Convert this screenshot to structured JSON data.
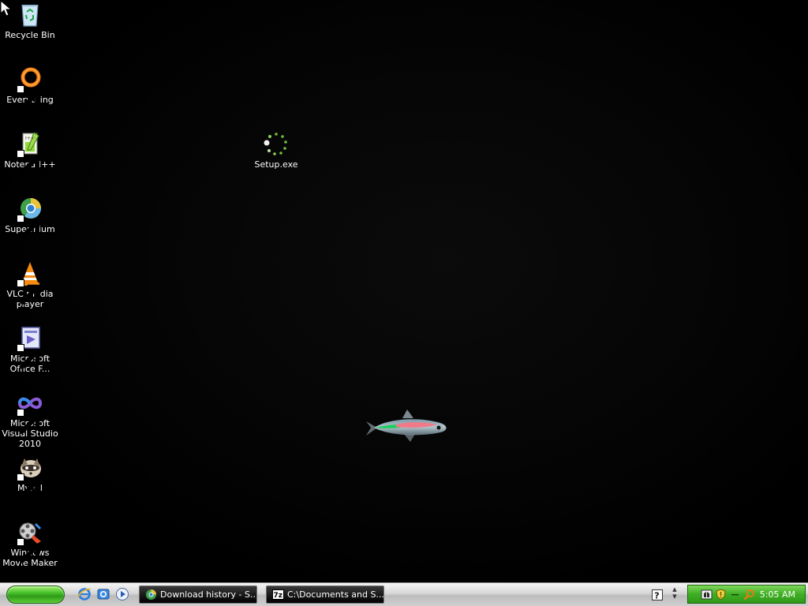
{
  "desktop": {
    "icons": [
      {
        "label": "Recycle Bin",
        "icon": "recycle-bin-icon"
      },
      {
        "label": "Everything",
        "icon": "everything-icon"
      },
      {
        "label": "Notepad++",
        "icon": "notepad-plus-plus-icon"
      },
      {
        "label": "Supermium",
        "icon": "supermium-icon"
      },
      {
        "label": "VLC media player",
        "icon": "vlc-icon"
      },
      {
        "label": "Microsoft Office F...",
        "icon": "office-frontpage-icon"
      },
      {
        "label": "Microsoft Visual Studio 2010",
        "icon": "visual-studio-icon"
      },
      {
        "label": "MyPal",
        "icon": "mypal-icon"
      },
      {
        "label": "Windows Movie Maker",
        "icon": "movie-maker-icon"
      },
      {
        "label": "Setup.exe",
        "icon": "setup-loading-icon"
      }
    ]
  },
  "taskbar": {
    "start_icon": "start-button",
    "quick_launch": [
      "internet-explorer-icon",
      "show-desktop-icon",
      "media-player-icon"
    ],
    "tasks": [
      {
        "label": "Download history - S...",
        "icon": "supermium-icon"
      },
      {
        "label": "C:\\Documents and S...",
        "icon": "7zip-icon"
      }
    ],
    "tray_icons": [
      "network-icon",
      "security-shield-icon",
      "search-icon"
    ],
    "clock": "5:05 AM"
  },
  "colors": {
    "desktop_background": "#000000",
    "start_green": "#3fae24",
    "tray_green": "#3fae24"
  }
}
